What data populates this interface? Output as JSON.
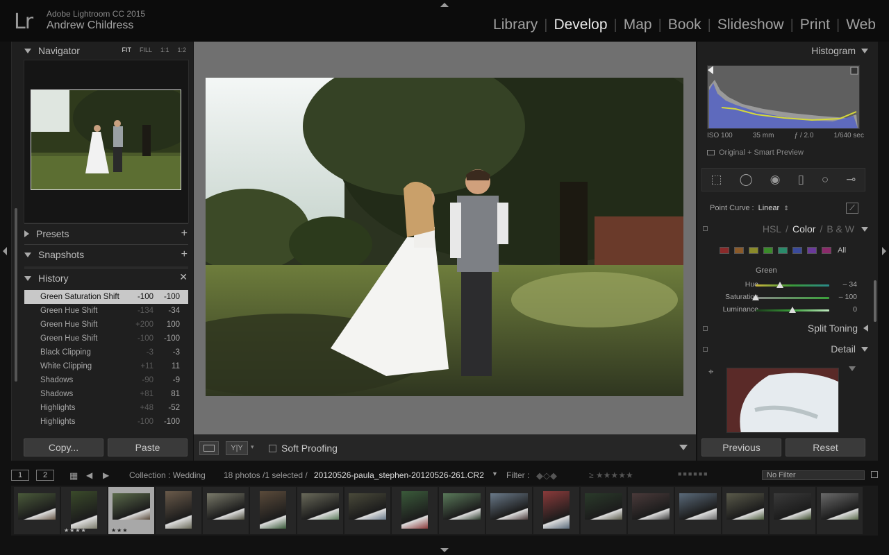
{
  "app": {
    "logo": "Lr",
    "name": "Adobe Lightroom CC 2015",
    "user": "Andrew Childress"
  },
  "modules": [
    "Library",
    "Develop",
    "Map",
    "Book",
    "Slideshow",
    "Print",
    "Web"
  ],
  "active_module": "Develop",
  "left": {
    "navigator": {
      "title": "Navigator",
      "zoom_options": [
        "FIT",
        "FILL",
        "1:1",
        "1:2"
      ],
      "active_zoom": "FIT"
    },
    "presets": {
      "title": "Presets"
    },
    "snapshots": {
      "title": "Snapshots"
    },
    "history": {
      "title": "History",
      "rows": [
        {
          "name": "Green Saturation Shift",
          "v1": "-100",
          "v2": "-100"
        },
        {
          "name": "Green Hue Shift",
          "v1": "-134",
          "v2": "-34"
        },
        {
          "name": "Green Hue Shift",
          "v1": "+200",
          "v2": "100"
        },
        {
          "name": "Green Hue Shift",
          "v1": "-100",
          "v2": "-100"
        },
        {
          "name": "Black Clipping",
          "v1": "-3",
          "v2": "-3"
        },
        {
          "name": "White Clipping",
          "v1": "+11",
          "v2": "11"
        },
        {
          "name": "Shadows",
          "v1": "-90",
          "v2": "-9"
        },
        {
          "name": "Shadows",
          "v1": "+81",
          "v2": "81"
        },
        {
          "name": "Highlights",
          "v1": "+48",
          "v2": "-52"
        },
        {
          "name": "Highlights",
          "v1": "-100",
          "v2": "-100"
        }
      ]
    },
    "copy_label": "Copy...",
    "paste_label": "Paste"
  },
  "toolbar": {
    "soft_proofing": "Soft Proofing"
  },
  "right": {
    "histogram_title": "Histogram",
    "exif": {
      "iso": "ISO 100",
      "focal": "35 mm",
      "aperture": "ƒ / 2.0",
      "shutter": "1/640 sec"
    },
    "smart_preview": "Original + Smart Preview",
    "point_curve_label": "Point Curve :",
    "point_curve_value": "Linear",
    "hsl_tabs": [
      "HSL",
      "Color",
      "B & W"
    ],
    "active_hsl_tab": "Color",
    "swatch_all": "All",
    "swatch_colors": [
      "#8a2a2a",
      "#8a5a2a",
      "#8a8a2a",
      "#3a8a2a",
      "#2a8a6a",
      "#3a4a9a",
      "#6a3a9a",
      "#8a2a6a"
    ],
    "color_section": "Green",
    "sliders": [
      {
        "label": "Hue",
        "value": "– 34",
        "level": 0.33
      },
      {
        "label": "Saturation",
        "value": "– 100",
        "level": 0.0
      },
      {
        "label": "Luminance",
        "value": "0",
        "level": 0.5
      }
    ],
    "split_toning": "Split Toning",
    "detail": "Detail",
    "previous_label": "Previous",
    "reset_label": "Reset"
  },
  "filmbar": {
    "page1": "1",
    "page2": "2",
    "collection": "Collection : Wedding",
    "count": "18 photos /1 selected /",
    "filename": "20120526-paula_stephen-20120526-261.CR2",
    "filter_label": "Filter :",
    "filter_value": "No Filter"
  },
  "filmstrip": {
    "thumbs": [
      {
        "orient": "land",
        "stars": ""
      },
      {
        "orient": "port",
        "stars": "★★★★"
      },
      {
        "orient": "land",
        "stars": "★★★",
        "selected": true
      },
      {
        "orient": "port",
        "stars": ""
      },
      {
        "orient": "land",
        "stars": ""
      },
      {
        "orient": "port",
        "stars": ""
      },
      {
        "orient": "land",
        "stars": ""
      },
      {
        "orient": "land",
        "stars": ""
      },
      {
        "orient": "port",
        "stars": ""
      },
      {
        "orient": "land",
        "stars": ""
      },
      {
        "orient": "land",
        "stars": ""
      },
      {
        "orient": "port",
        "stars": ""
      },
      {
        "orient": "land",
        "stars": ""
      },
      {
        "orient": "land",
        "stars": ""
      },
      {
        "orient": "land",
        "stars": ""
      },
      {
        "orient": "land",
        "stars": ""
      },
      {
        "orient": "land",
        "stars": ""
      },
      {
        "orient": "land",
        "stars": ""
      }
    ]
  }
}
